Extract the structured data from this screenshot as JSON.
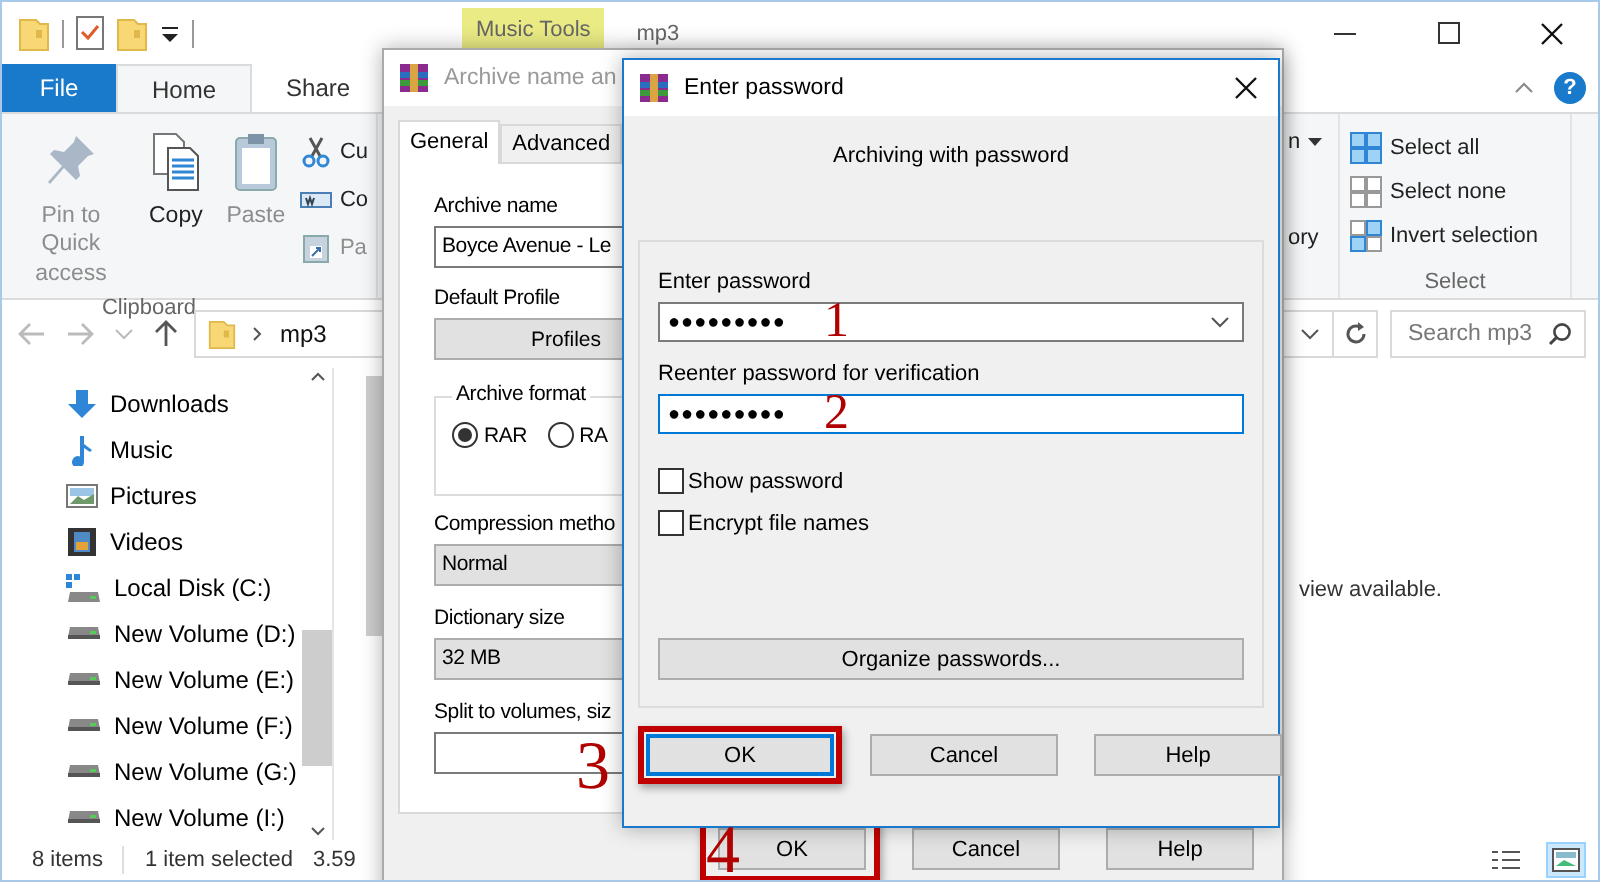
{
  "explorer": {
    "context_tab": "Music Tools",
    "title": "mp3",
    "ribbon_tabs": [
      {
        "label": "File",
        "kind": "file",
        "selected": false
      },
      {
        "label": "Home",
        "kind": "tab",
        "selected": true
      },
      {
        "label": "Share",
        "kind": "tab",
        "selected": false
      }
    ],
    "help_glyph": "?",
    "clipboard": {
      "label": "Clipboard",
      "large_buttons": [
        {
          "label": "Pin to Quick access",
          "kind": "pin",
          "disabled": true
        },
        {
          "label": "Copy",
          "kind": "copy",
          "disabled": false
        },
        {
          "label": "Paste",
          "kind": "paste",
          "disabled": true
        }
      ],
      "small_buttons": [
        {
          "label": "Cu",
          "kind": "cut",
          "disabled": false
        },
        {
          "label": "Co",
          "kind": "copy-path",
          "disabled": false
        },
        {
          "label": "Pa",
          "kind": "paste-shortcut",
          "disabled": true
        }
      ]
    },
    "open_group": [
      {
        "label": "n",
        "dropdown": true
      },
      {
        "label": "ory",
        "dropdown": false
      }
    ],
    "select_group": {
      "label": "Select",
      "items": [
        {
          "label": "Select all",
          "kind": "all"
        },
        {
          "label": "Select none",
          "kind": "none"
        },
        {
          "label": "Invert selection",
          "kind": "invert"
        }
      ]
    },
    "address": {
      "path": "mp3",
      "search_placeholder": "Search mp3"
    },
    "nav_items": [
      {
        "label": "Downloads",
        "kind": "downloads"
      },
      {
        "label": "Music",
        "kind": "music"
      },
      {
        "label": "Pictures",
        "kind": "pictures"
      },
      {
        "label": "Videos",
        "kind": "videos"
      },
      {
        "label": "Local Disk (C:)",
        "kind": "system-drive"
      },
      {
        "label": "New Volume (D:)",
        "kind": "drive"
      },
      {
        "label": "New Volume (E:)",
        "kind": "drive"
      },
      {
        "label": "New Volume (F:)",
        "kind": "drive"
      },
      {
        "label": "New Volume (G:)",
        "kind": "drive"
      },
      {
        "label": "New Volume (I:)",
        "kind": "drive"
      }
    ],
    "content_message": "view available.",
    "status": {
      "item_count": "8 items",
      "selection": "1 item selected",
      "size": "3.59"
    }
  },
  "archive_dialog": {
    "title": "Archive name an",
    "tabs": [
      {
        "label": "General",
        "selected": true
      },
      {
        "label": "Advanced",
        "selected": false
      }
    ],
    "archive_name": {
      "label": "Archive name",
      "value": "Boyce Avenue - Le"
    },
    "profile": {
      "label": "Default Profile",
      "button": "Profiles"
    },
    "format": {
      "label": "Archive format",
      "options": [
        {
          "label": "RAR",
          "checked": true
        },
        {
          "label": "RA",
          "checked": false
        }
      ]
    },
    "compression": {
      "label": "Compression metho",
      "value": "Normal"
    },
    "dictionary": {
      "label": "Dictionary size",
      "value": "32 MB"
    },
    "split": {
      "label": "Split to volumes, siz"
    },
    "buttons": [
      {
        "label": "OK",
        "highlighted": true
      },
      {
        "label": "Cancel",
        "highlighted": false
      },
      {
        "label": "Help",
        "highlighted": false
      }
    ]
  },
  "password_dialog": {
    "title": "Enter password",
    "subtitle": "Archiving with password",
    "password": {
      "label": "Enter password",
      "value": "●●●●●●●●●",
      "focused": false
    },
    "verify": {
      "label": "Reenter password for verification",
      "value": "●●●●●●●●●",
      "focused": true
    },
    "options": [
      {
        "label": "Show password",
        "checked": false
      },
      {
        "label": "Encrypt file names",
        "checked": false
      }
    ],
    "organize_button": "Organize passwords...",
    "buttons": [
      {
        "label": "OK",
        "highlighted": true,
        "default": true
      },
      {
        "label": "Cancel",
        "highlighted": false,
        "default": false
      },
      {
        "label": "Help",
        "highlighted": false,
        "default": false
      }
    ]
  },
  "annotations": [
    {
      "label": "1"
    },
    {
      "label": "2"
    },
    {
      "label": "3"
    },
    {
      "label": "4"
    }
  ]
}
